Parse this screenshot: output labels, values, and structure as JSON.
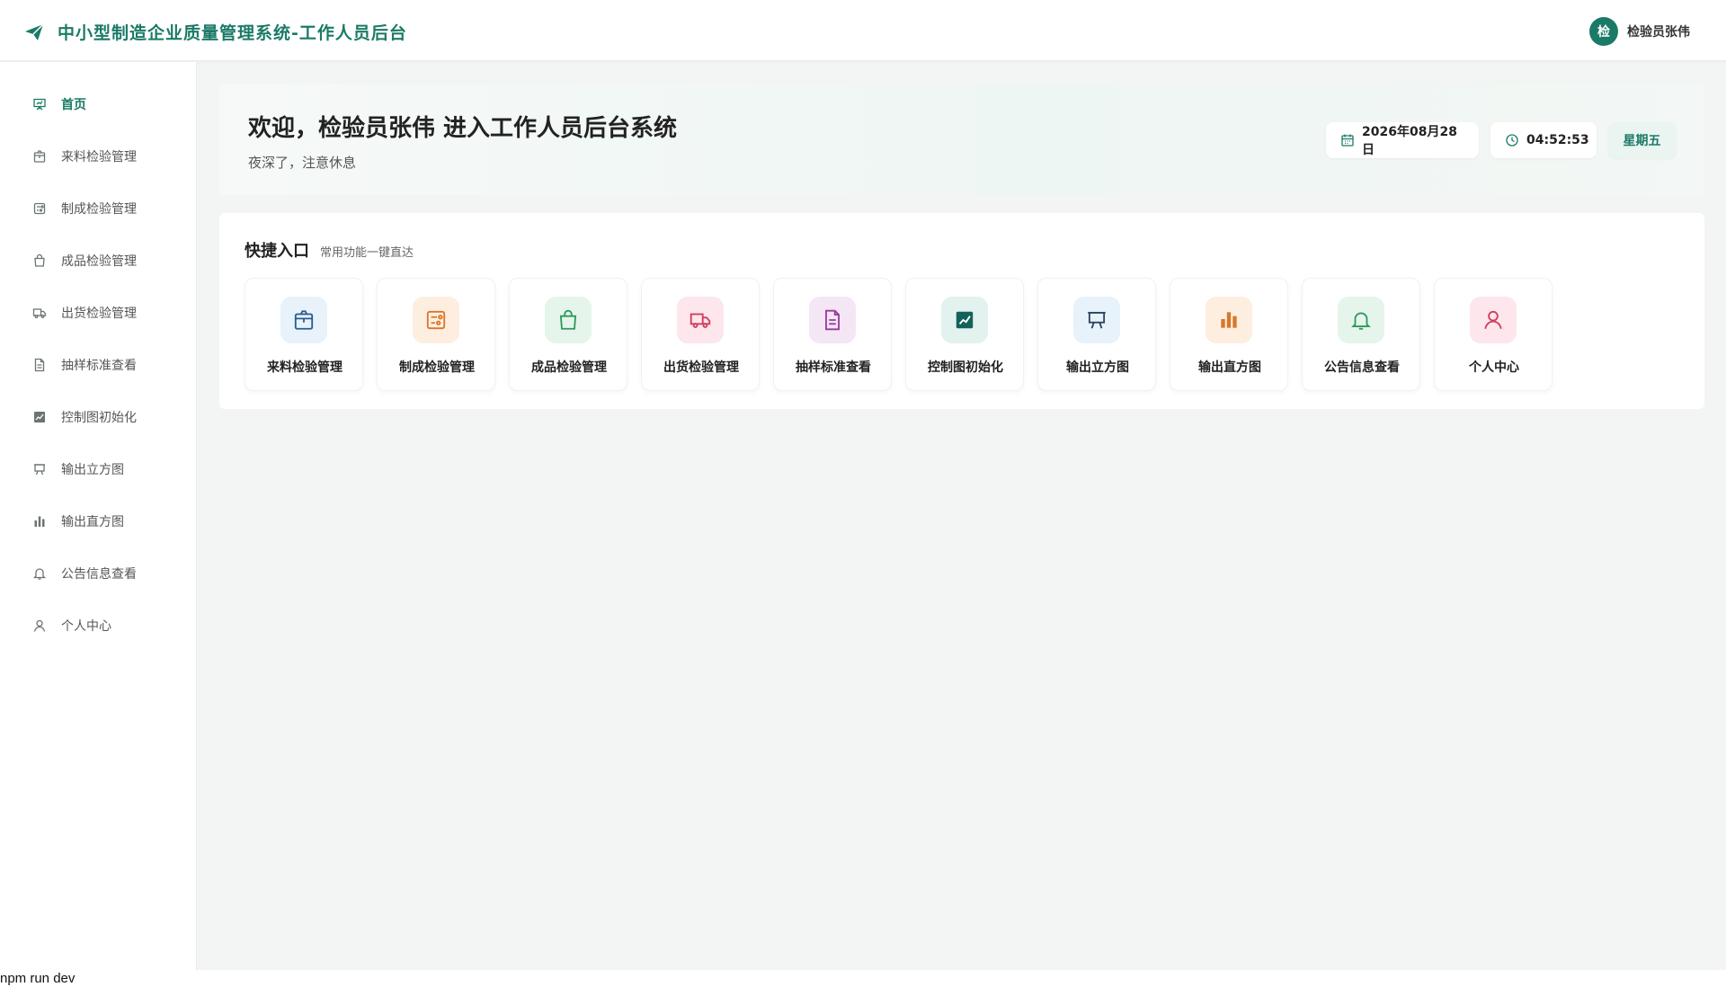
{
  "header": {
    "title": "中小型制造企业质量管理系统-工作人员后台",
    "brand_icon": "paper-plane-icon",
    "user": {
      "avatar_text": "检",
      "name": "检验员张伟"
    }
  },
  "sidebar": {
    "items": [
      {
        "label": "首页",
        "icon": "presentation-icon",
        "active": true
      },
      {
        "label": "来料检验管理",
        "icon": "box-icon"
      },
      {
        "label": "制成检验管理",
        "icon": "process-icon"
      },
      {
        "label": "成品检验管理",
        "icon": "bag-icon"
      },
      {
        "label": "出货检验管理",
        "icon": "truck-icon"
      },
      {
        "label": "抽样标准查看",
        "icon": "document-icon"
      },
      {
        "label": "控制图初始化",
        "icon": "chart-icon"
      },
      {
        "label": "输出立方图",
        "icon": "easel-icon"
      },
      {
        "label": "输出直方图",
        "icon": "bar-chart-icon"
      },
      {
        "label": "公告信息查看",
        "icon": "bell-icon"
      },
      {
        "label": "个人中心",
        "icon": "user-icon"
      }
    ]
  },
  "welcome": {
    "heading": "欢迎，检验员张伟 进入工作人员后台系统",
    "subtitle": "夜深了，注意休息",
    "date": "2026年08月28日",
    "time": "04:52:53",
    "weekday": "星期五"
  },
  "quick": {
    "title": "快捷入口",
    "subtitle": "常用功能一键直达",
    "items": [
      {
        "label": "来料检验管理",
        "icon": "box-icon",
        "bg": "#e8f2fb",
        "color": "#2b5d8a"
      },
      {
        "label": "制成检验管理",
        "icon": "process-icon",
        "bg": "#fdeee0",
        "color": "#d9772b"
      },
      {
        "label": "成品检验管理",
        "icon": "bag-icon",
        "bg": "#e5f5ec",
        "color": "#2e9a5e"
      },
      {
        "label": "出货检验管理",
        "icon": "truck-icon",
        "bg": "#fde6ec",
        "color": "#d23c5e"
      },
      {
        "label": "抽样标准查看",
        "icon": "document-icon",
        "bg": "#f4e6f5",
        "color": "#9a3aa0"
      },
      {
        "label": "控制图初始化",
        "icon": "chart-icon",
        "bg": "#e2f2ee",
        "color": "#13635a"
      },
      {
        "label": "输出立方图",
        "icon": "easel-icon",
        "bg": "#e8f2fb",
        "color": "#2b4560"
      },
      {
        "label": "输出直方图",
        "icon": "bar-chart-icon",
        "bg": "#fdeee0",
        "color": "#d9772b"
      },
      {
        "label": "公告信息查看",
        "icon": "bell-icon",
        "bg": "#e5f5ec",
        "color": "#2e9a5e"
      },
      {
        "label": "个人中心",
        "icon": "user-icon",
        "bg": "#fde6ec",
        "color": "#d23c5e"
      }
    ]
  },
  "footer": {
    "text": "npm run dev"
  },
  "colors": {
    "accent": "#1b7a67",
    "background": "#f3f5f4"
  }
}
